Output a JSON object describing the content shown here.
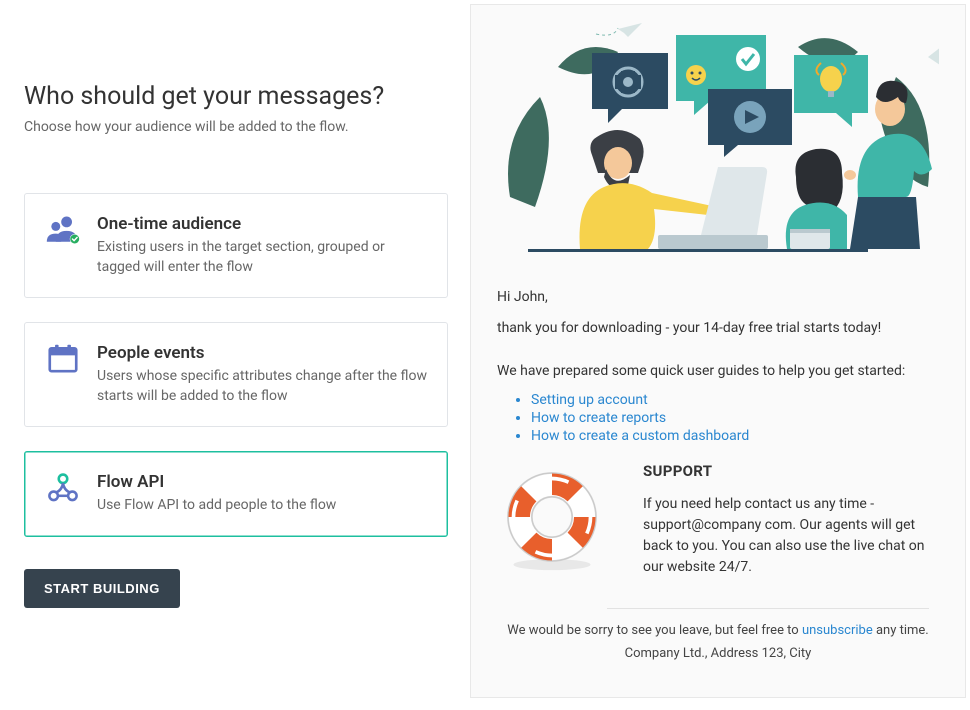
{
  "left": {
    "heading": "Who should get your messages?",
    "subtitle": "Choose how your audience will be added to the flow.",
    "options": [
      {
        "title": "One-time audience",
        "desc": "Existing users in the target section, grouped or tagged will enter the flow"
      },
      {
        "title": "People events",
        "desc": "Users whose specific attributes change after the flow starts will be added to the flow"
      },
      {
        "title": "Flow API",
        "desc": "Use Flow API to add people to the flow"
      }
    ],
    "start_button": "START BUILDING"
  },
  "email": {
    "greeting": "Hi John,",
    "line1": "thank you for downloading - your 14-day free trial starts today!",
    "line2": "We have prepared some quick user guides to help you get started:",
    "links": [
      "Setting up account",
      "How to create reports",
      "How to create a custom dashboard"
    ],
    "support": {
      "title": "SUPPORT",
      "text": "If you need help contact us any time - support@company com. Our agents will get back to you. You can also use the live chat on our website 24/7."
    },
    "footer": {
      "pre": "We would be sorry to see you leave, but feel free to ",
      "unsubscribe": "unsubscribe",
      "post": " any time.",
      "address": "Company Ltd., Address 123, City"
    }
  },
  "colors": {
    "accent": "#1dbf9f",
    "link": "#2a87d0",
    "teal": "#3fb6a8",
    "navy": "#2c4b62",
    "yellow": "#f6d24c",
    "orange": "#e85f2c",
    "leaf": "#3e6b5f"
  }
}
